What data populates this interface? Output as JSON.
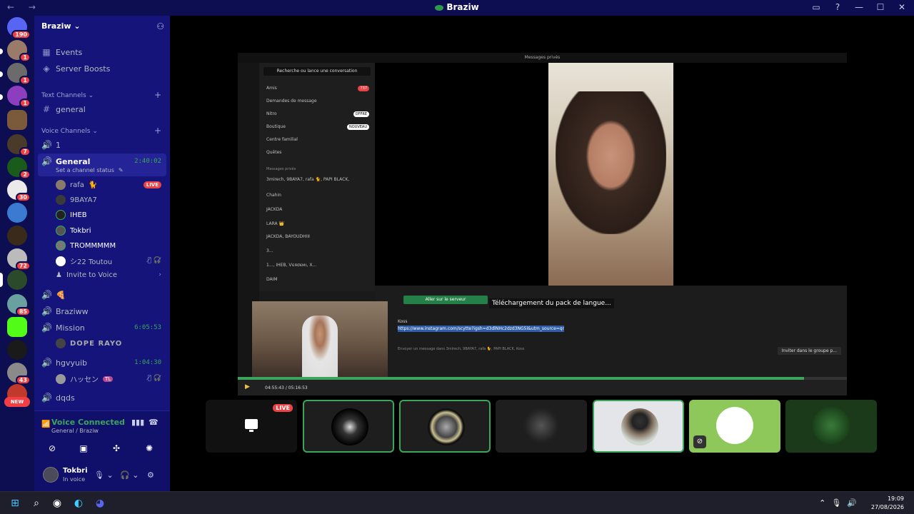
{
  "window": {
    "title": "Braziw",
    "nav_arrows": "← →",
    "controls": [
      "▭",
      "?",
      "—",
      "☐",
      "✕"
    ]
  },
  "guild_badges": {
    "home": "190",
    "b1": "1",
    "b2": "1",
    "b3": "1",
    "b4": "7",
    "b5": "2",
    "b6": "30",
    "b7": "72",
    "b8": "85",
    "b9": "43",
    "new_label": "NEW"
  },
  "server": {
    "name": "Braziw",
    "menu": [
      {
        "label": "Events",
        "icon": "calendar-icon"
      },
      {
        "label": "Server Boosts",
        "icon": "boost-icon"
      }
    ],
    "text_category": "Text Channels",
    "text_channels": [
      "general"
    ],
    "voice_category": "Voice Channels",
    "voice_1": "1",
    "general": {
      "name": "General",
      "timer": "2:40:02",
      "status_prompt": "Set a channel status",
      "users": [
        {
          "name": "rafa",
          "live": "LIVE"
        },
        {
          "name": "9BAYA7"
        },
        {
          "name": "IHEB"
        },
        {
          "name": "Tokbri"
        },
        {
          "name": "TROMMMMM"
        },
        {
          "name": "シ22 Toutou"
        }
      ],
      "invite": "Invite to Voice"
    },
    "pizza_channel": "🍕",
    "braziww": "Braziww",
    "mission": {
      "name": "Mission",
      "timer": "6:05:53",
      "user": "DOPE RAYO"
    },
    "hgvyuib": {
      "name": "hgvyuib",
      "timer": "1:04:30",
      "user": "ハッセン",
      "tag": "TL"
    },
    "dqds": "dqds"
  },
  "voice_panel": {
    "title": "Voice Connected",
    "subtitle": "General / Braziw",
    "user_name": "Tokbri",
    "user_status": "In voice"
  },
  "stream": {
    "title": "Messages privés",
    "search": "Recherche ou lance une conversation",
    "nav": [
      {
        "label": "Amis",
        "badge": "737"
      },
      {
        "label": "Demandes de message"
      },
      {
        "label": "Nitro",
        "badge": "OFFRE"
      },
      {
        "label": "Boutique",
        "badge": "NOUVEAU"
      },
      {
        "label": "Centre familial"
      },
      {
        "label": "Quêtes"
      }
    ],
    "dm_header": "Messages privés",
    "dms": [
      "3mirech, 9BAYA7, rafa 🐈, PAPI BLACK,",
      "Chahin",
      "JACKDA",
      "LARA 👑",
      "JACKDA, BAYOUDHIII",
      "3...",
      "1..., IHEB, Ѵєяσємι, X...",
      "DAIM"
    ],
    "join_button": "Aller sur le serveur",
    "tooltip": "Téléchargement du pack de langue...",
    "msg_author": "Koss",
    "link": "https://www.instagram.com/scytte?igsh=d3dlNHc2dzd3NG5l&utm_source=qr",
    "input_placeholder": "Envoyer un message dans 3mirech, 9BAYA7, rafa 🐈, PAPI BLACK, Koss",
    "invite_group": "Inviter dans le groupe p...",
    "time": "04:55:43 / 05:16:53",
    "progress": 0.93
  },
  "tiles": {
    "live_label": "LIVE"
  },
  "taskbar": {
    "time": "19:09",
    "date": "27/08/2026"
  }
}
